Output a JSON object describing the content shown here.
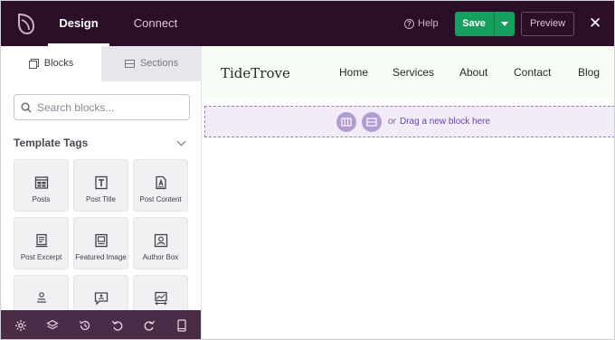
{
  "topbar": {
    "tabs": {
      "design": "Design",
      "connect": "Connect"
    },
    "help_label": "Help",
    "save_label": "Save",
    "preview_label": "Preview",
    "close_glyph": "✕"
  },
  "sidebar": {
    "tabs": {
      "blocks": "Blocks",
      "sections": "Sections"
    },
    "search": {
      "placeholder": "Search blocks..."
    },
    "template_tags": {
      "title": "Template Tags",
      "tiles": [
        {
          "label": "Posts",
          "icon": "posts-icon"
        },
        {
          "label": "Post Title",
          "icon": "post-title-icon"
        },
        {
          "label": "Post Content",
          "icon": "post-content-icon"
        },
        {
          "label": "Post Excerpt",
          "icon": "post-excerpt-icon"
        },
        {
          "label": "Featured Image",
          "icon": "featured-image-icon"
        },
        {
          "label": "Author Box",
          "icon": "author-box-icon"
        },
        {
          "label": "",
          "icon": "post-info-icon"
        },
        {
          "label": "",
          "icon": "comments-icon"
        },
        {
          "label": "",
          "icon": "post-navigation-icon"
        }
      ]
    },
    "bottom_tools": [
      "settings-icon",
      "layers-icon",
      "history-icon",
      "undo-icon",
      "redo-icon",
      "device-preview-icon"
    ]
  },
  "canvas": {
    "site_title": "TideTrove",
    "nav": [
      "Home",
      "Services",
      "About",
      "Contact",
      "Blog"
    ],
    "dropzone": {
      "or_text": "or",
      "drag_text": "Drag a new block here"
    }
  },
  "colors": {
    "topbar_bg": "#2b0e27",
    "save_green": "#16a05d",
    "bottombar_bg": "#4a2b48",
    "dropzone_accent": "#6f43a8",
    "header_bg": "#f7fcf5"
  }
}
